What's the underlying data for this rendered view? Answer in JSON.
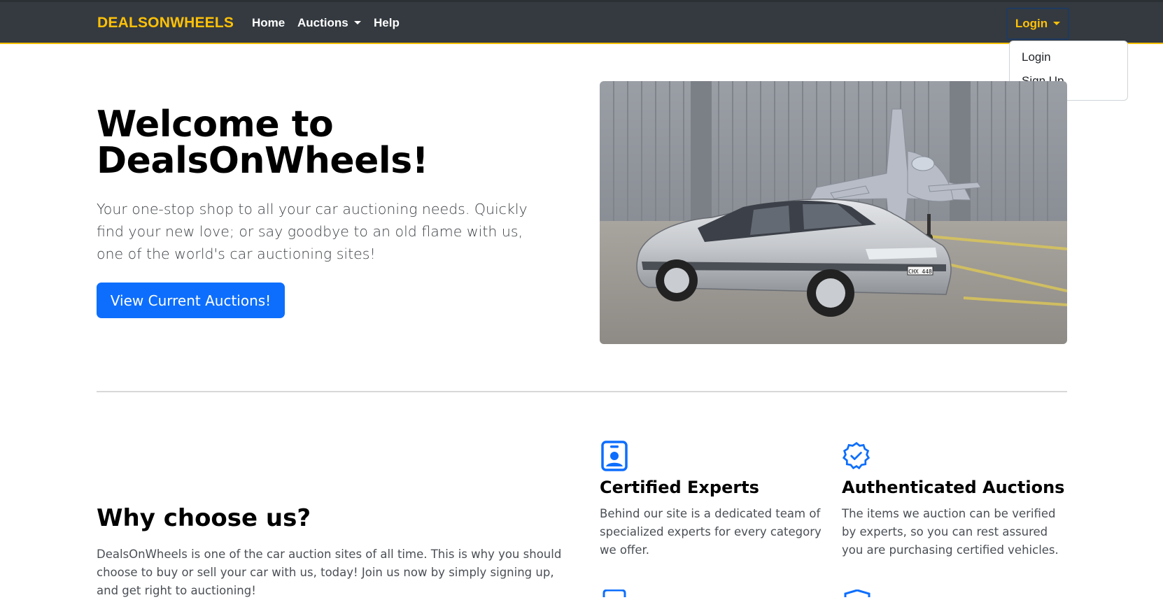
{
  "navbar": {
    "brand": "DEALSONWHEELS",
    "links": [
      {
        "label": "Home"
      },
      {
        "label": "Auctions",
        "has_dropdown": true
      },
      {
        "label": "Help"
      }
    ],
    "login_toggle": "Login",
    "dropdown": {
      "items": [
        "Login",
        "Sign Up"
      ]
    }
  },
  "hero": {
    "title": "Welcome to DealsOnWheels!",
    "lead": "Your one-stop shop to all your car auctioning needs. Quickly find your new love; or say goodbye to an old flame with us, one of the world's car auctioning sites!",
    "cta": "View Current Auctions!",
    "image_plate": "CHX 448"
  },
  "why": {
    "title": "Why choose us?",
    "text": "DealsOnWheels is one of the car auction sites of all time. This is why you should choose to buy or sell your car with us, today! Join us now by simply signing up, and get right to auctioning!"
  },
  "features": [
    {
      "title": "Certified Experts",
      "text": "Behind our site is a dedicated team of specialized experts for every category we offer.",
      "icon": "person-badge-icon"
    },
    {
      "title": "Authenticated Auctions",
      "text": "The items we auction can be verified by experts, so you can rest assured you are purchasing certified vehicles.",
      "icon": "patch-check-icon"
    }
  ],
  "colors": {
    "navbar_bg": "#343a40",
    "brand": "#ffc107",
    "primary": "#0d6efd"
  }
}
